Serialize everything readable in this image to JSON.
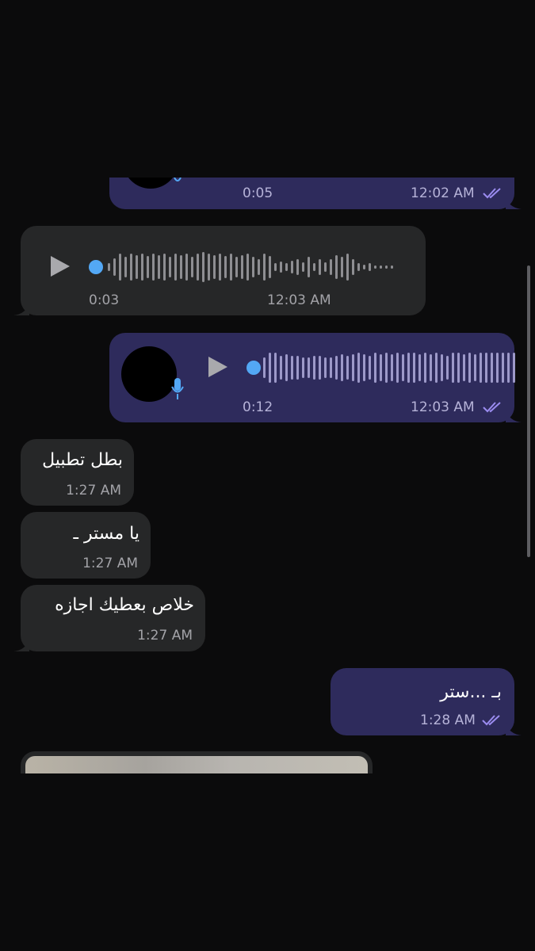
{
  "messages": [
    {
      "id": "m1",
      "direction": "outgoing",
      "type": "voice",
      "duration": "0:05",
      "time": "12:02 AM",
      "read": true
    },
    {
      "id": "m2",
      "direction": "incoming",
      "type": "voice",
      "duration": "0:03",
      "time": "12:03 AM"
    },
    {
      "id": "m3",
      "direction": "outgoing",
      "type": "voice",
      "duration": "0:12",
      "time": "12:03 AM",
      "read": true
    },
    {
      "id": "m4",
      "direction": "incoming",
      "type": "text",
      "text": "بطل تطبيل",
      "time": "1:27 AM"
    },
    {
      "id": "m5",
      "direction": "incoming",
      "type": "text",
      "text": "يا مستر ـ",
      "time": "1:27 AM"
    },
    {
      "id": "m6",
      "direction": "incoming",
      "type": "text",
      "text": "خلاص بعطيك اجازه",
      "time": "1:27 AM"
    },
    {
      "id": "m7",
      "direction": "outgoing",
      "type": "text",
      "text": "بـ ...ستر",
      "time": "1:28 AM",
      "read": true
    },
    {
      "id": "m8",
      "direction": "incoming",
      "type": "image"
    }
  ],
  "colors": {
    "background": "#0b0b0c",
    "incoming_bubble": "#262728",
    "outgoing_bubble": "#2e2b5c",
    "accent": "#53a8f5",
    "read_checks": "#9b8cf0"
  },
  "icons": {
    "play": "play-icon",
    "mic": "microphone-icon",
    "read": "double-check-icon"
  }
}
